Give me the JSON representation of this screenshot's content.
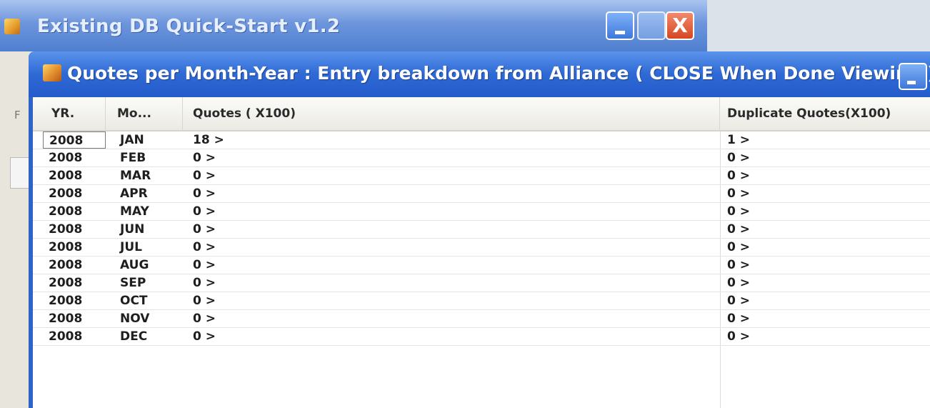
{
  "outer_window": {
    "title": "Existing DB Quick-Start v1.2",
    "close_glyph": "X",
    "side_letter": "F"
  },
  "inner_window": {
    "title": "Quotes per Month-Year : Entry breakdown from Alliance ( CLOSE When Done Viewing )"
  },
  "grid": {
    "columns": [
      "YR.",
      "Mo...",
      "Quotes ( X100)",
      "Duplicate Quotes(X100)"
    ],
    "rows": [
      {
        "yr": "2008",
        "mo": "JAN",
        "quotes": "18 >",
        "dup": "1 >"
      },
      {
        "yr": "2008",
        "mo": "FEB",
        "quotes": "0 >",
        "dup": "0 >"
      },
      {
        "yr": "2008",
        "mo": "MAR",
        "quotes": "0 >",
        "dup": "0 >"
      },
      {
        "yr": "2008",
        "mo": "APR",
        "quotes": "0 >",
        "dup": "0 >"
      },
      {
        "yr": "2008",
        "mo": "MAY",
        "quotes": "0 >",
        "dup": "0 >"
      },
      {
        "yr": "2008",
        "mo": "JUN",
        "quotes": "0 >",
        "dup": "0 >"
      },
      {
        "yr": "2008",
        "mo": "JUL",
        "quotes": "0 >",
        "dup": "0 >"
      },
      {
        "yr": "2008",
        "mo": "AUG",
        "quotes": "0 >",
        "dup": "0 >"
      },
      {
        "yr": "2008",
        "mo": "SEP",
        "quotes": "0 >",
        "dup": "0 >"
      },
      {
        "yr": "2008",
        "mo": "OCT",
        "quotes": "0 >",
        "dup": "0 >"
      },
      {
        "yr": "2008",
        "mo": "NOV",
        "quotes": "0 >",
        "dup": "0 >"
      },
      {
        "yr": "2008",
        "mo": "DEC",
        "quotes": "0 >",
        "dup": "0 >"
      }
    ]
  },
  "icons": {
    "outer_app": "app-icon",
    "inner_app": "app-icon",
    "minimize": "minimize-icon",
    "maximize": "maximize-icon",
    "close": "close-icon"
  },
  "colors": {
    "titlebar_blue": "#2e69d5",
    "close_red": "#d54622",
    "grid_background": "#ffffff"
  }
}
